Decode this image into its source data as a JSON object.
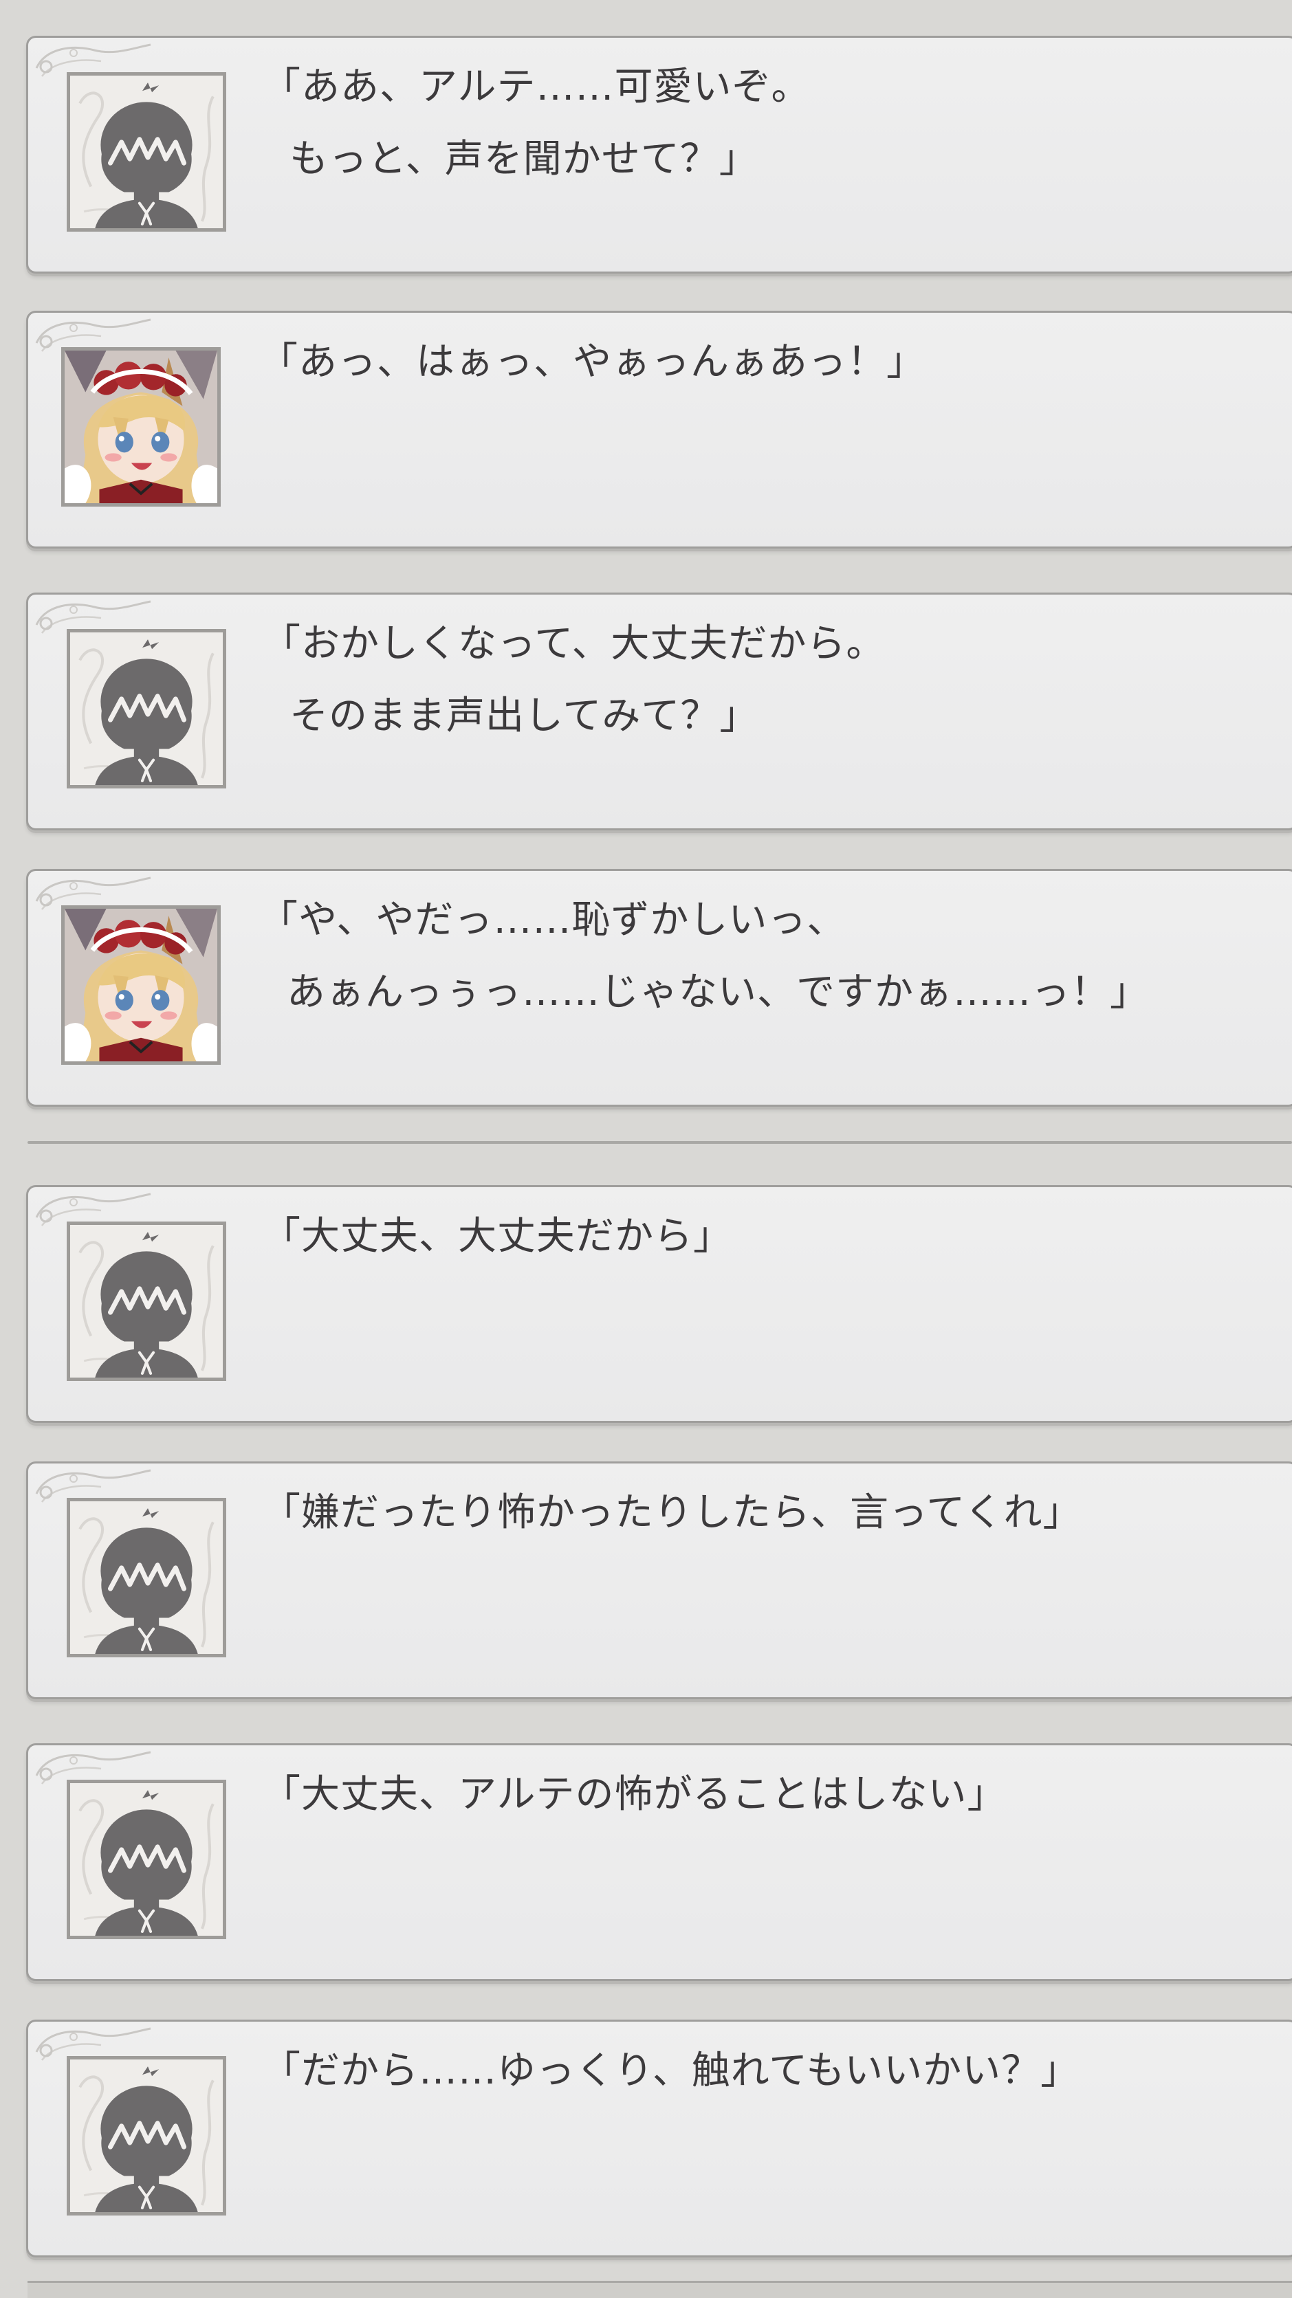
{
  "colors": {
    "background": "#d9d8d5",
    "panel": "#ececec",
    "panel_border": "#9f9e9c",
    "text": "#3c3a3c"
  },
  "messages": [
    {
      "speaker_icon": "hero-silhouette-icon",
      "line1": "「ああ、アルテ……可愛いぞ。",
      "line2": "もっと、声を聞かせて？」"
    },
    {
      "speaker_icon": "arte-portrait-icon",
      "line1": "「あっ、はぁっ、やぁっんぁあっ！」",
      "line2": ""
    },
    {
      "speaker_icon": "hero-silhouette-icon",
      "line1": "「おかしくなって、大丈夫だから。",
      "line2": "そのまま声出してみて？」"
    },
    {
      "speaker_icon": "arte-portrait-icon",
      "line1": "「や、やだっ……恥ずかしいっ、",
      "line2": "あぁんっぅっ……じゃない、ですかぁ……っ！」"
    },
    {
      "speaker_icon": "hero-silhouette-icon",
      "line1": "「大丈夫、大丈夫だから」",
      "line2": ""
    },
    {
      "speaker_icon": "hero-silhouette-icon",
      "line1": "「嫌だったり怖かったりしたら、言ってくれ」",
      "line2": ""
    },
    {
      "speaker_icon": "hero-silhouette-icon",
      "line1": "「大丈夫、アルテの怖がることはしない」",
      "line2": ""
    },
    {
      "speaker_icon": "hero-silhouette-icon",
      "line1": "「だから……ゆっくり、触れてもいいかい？」",
      "line2": ""
    }
  ]
}
